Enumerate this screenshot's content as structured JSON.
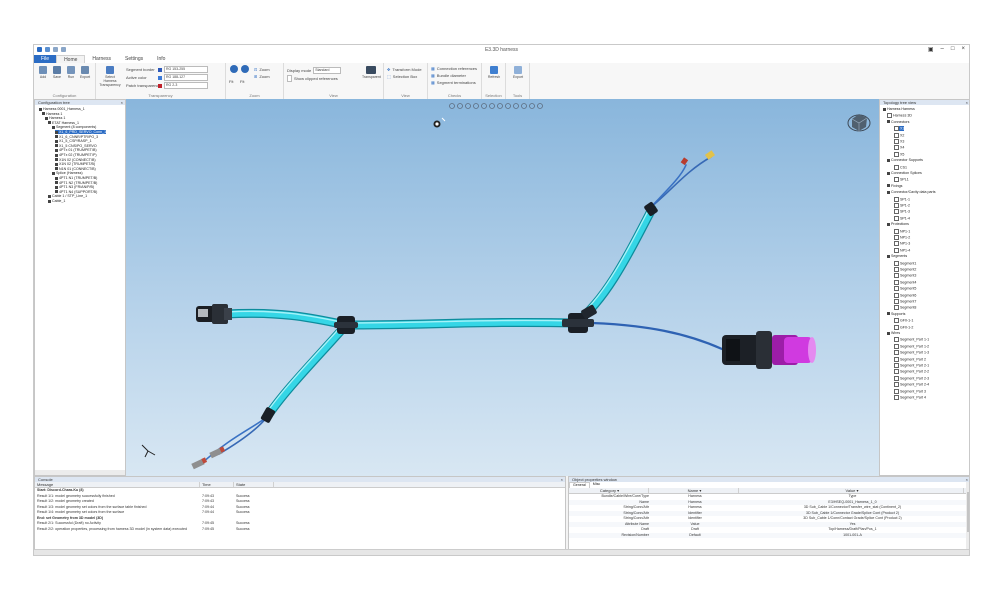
{
  "window": {
    "title": "E3.3D harness"
  },
  "ribbon": {
    "tabs": [
      "File",
      "Home",
      "Harness",
      "Settings",
      "Info"
    ],
    "active_tab": 0,
    "selected_tab": 1,
    "groups": [
      {
        "label": "Configuration",
        "buttons": [
          "Add",
          "Save",
          "Run",
          "Export"
        ]
      },
      {
        "label": "Transparency",
        "button": "Select Harness Transparency",
        "rows": [
          {
            "label": "Segment border",
            "color": "#2e59b8",
            "value": "RG 153-255"
          },
          {
            "label": "Active color",
            "color": "#3b7ad8",
            "value": "RG 188-127"
          },
          {
            "label": "Patch transparency",
            "color": "#c0202a",
            "value": "RG 2-3"
          }
        ]
      },
      {
        "label": "Zoom",
        "rows": [
          "Zoom",
          "Zoom",
          "Fit",
          "Fit"
        ]
      },
      {
        "label": "View",
        "rows": [
          "Display mode",
          "Show clipped references"
        ],
        "combo": "Standard",
        "button": "Transparent"
      },
      {
        "label": "View",
        "rows": [
          "Transform Mode",
          "Selection Box"
        ]
      },
      {
        "label": "Checks",
        "rows": [
          "Connection references",
          "Bundle diameter",
          "Segment terminations"
        ]
      },
      {
        "label": "Selection",
        "button": "Refresh"
      },
      {
        "label": "Tools",
        "button": "Export"
      }
    ]
  },
  "left_panel": {
    "title": "Configuration tree",
    "nodes": [
      "Harness 0001_Harness_1",
      "Harness 1",
      "Harness 1",
      "ETAT Harness_1",
      "Segment (8 components)",
      "X1_6_PRD_SERVO_Conn_1",
      "X1_6_CNNR/PTR/PO_3",
      "X1_5_CSP/RASP_1",
      "X1_5 CNS/PO_SERVO",
      "4PTx 01 (TRUMPET/B)",
      "4PTx 02 (TRUMPET/P)",
      "X1N 02 (CONNECT/B)",
      "X1N 02 (TRUMPET/B)",
      "N1N 01 (CONNECT/B)",
      "Splice (Harness)",
      "4PT1 N1 (TRUMPET/B)",
      "4PT1 N2 (TRUMPET/B)",
      "4PT1 N3 (FR/AN/P/B)",
      "4PT1 N4 (SUPPORT/B)",
      "Cable 1 / STP_Line_1",
      "Cable_1"
    ]
  },
  "right_panel": {
    "title": "Topology tree view",
    "nodes": [
      "Harness Harness",
      "Harness 3D",
      "Connectors",
      "X1",
      "X2",
      "X3",
      "X4",
      "X5",
      "Connector Supports",
      "CS1",
      "Connection Splices",
      "SPL1",
      "Fixings",
      "Connector/Cavity data parts",
      "SP1-1",
      "SP1-2",
      "SP1-3",
      "SP1-4",
      "Protections",
      "NP1-1",
      "NP1-2",
      "NP1-3",
      "NP1-4",
      "Segments",
      "Segment1",
      "Segment2",
      "Segment3",
      "Segment4",
      "Segment5",
      "Segment6",
      "Segment7",
      "Segment8",
      "Supports",
      "GF0-1-1",
      "GF0-1-2",
      "Wires",
      "Segment_Part 1-1",
      "Segment_Part 1-2",
      "Segment_Part 1-3",
      "Segment_Part 2",
      "Segment_Part 2-1",
      "Segment_Part 2-2",
      "Segment_Part 2-3",
      "Segment_Part 2-4",
      "Segment_Part 3",
      "Segment_Part 4"
    ]
  },
  "console": {
    "title": "Console",
    "columns": [
      "Message",
      "Time",
      "State"
    ],
    "rows": [
      {
        "bold": true,
        "message": "Start: Discord-Chara-Ku (8)",
        "time": "",
        "state": ""
      },
      {
        "bold": false,
        "message": "Result 1/1: model geometry successfully finished",
        "time": "7:09:43",
        "state": "Success"
      },
      {
        "bold": false,
        "message": "Result 1/2: model geometry created",
        "time": "7:09:43",
        "state": "Success"
      },
      {
        "bold": false,
        "message": "Result 1/3: model geometry set colors from the surface table finished",
        "time": "7:09:44",
        "state": "Success"
      },
      {
        "bold": false,
        "message": "Result 1/4: model geometry set colors from the surface",
        "time": "7:09:44",
        "state": "Success"
      },
      {
        "bold": true,
        "message": "End: set Geometry from 3D model (3D)",
        "time": "",
        "state": ""
      },
      {
        "bold": false,
        "message": "Result 2/1: Successful (Draft) no Activity",
        "time": "7:09:45",
        "state": "Success"
      },
      {
        "bold": false,
        "message": "Result 2/2: operation properties, processing from harness 3D model (in system data) executed",
        "time": "7:09:45",
        "state": "Success"
      }
    ]
  },
  "properties": {
    "title": "Object properties window",
    "tabs": [
      "General",
      "Misc"
    ],
    "columns": [
      "Category",
      "Name",
      "Value"
    ],
    "rows": [
      {
        "category": "Bundle/Cable/Wire/Core/Type",
        "name": "Harness",
        "value": "Type"
      },
      {
        "category": "Name",
        "name": "Harness",
        "value": "E3/HSEQ-0001_Harness_1_0"
      },
      {
        "category": "String/Conn/Attr",
        "name": "Harness",
        "value": "3D Sub_Cable 1/Connector/Transfer_wire_stat (Continent_2)"
      },
      {
        "category": "String/Conn/Attr",
        "name": "Identifier",
        "value": "3D Sub_Cable 1/Connector Grade/Splice Cont (Product 2)"
      },
      {
        "category": "String/Conn/Attr",
        "name": "Identifier",
        "value": "3D Sub_Cable 1/Conn/Contact Grade/Splice Cont (Product 2)"
      },
      {
        "category": "Attribute Name",
        "name": "Value",
        "value": "Yes"
      },
      {
        "category": "Draft",
        "name": "Draft",
        "value": "Top/Harness/Draft/Plan/Pos_1"
      },
      {
        "category": "Revision/Number",
        "name": "Default",
        "value": "1001-001-A"
      }
    ]
  }
}
